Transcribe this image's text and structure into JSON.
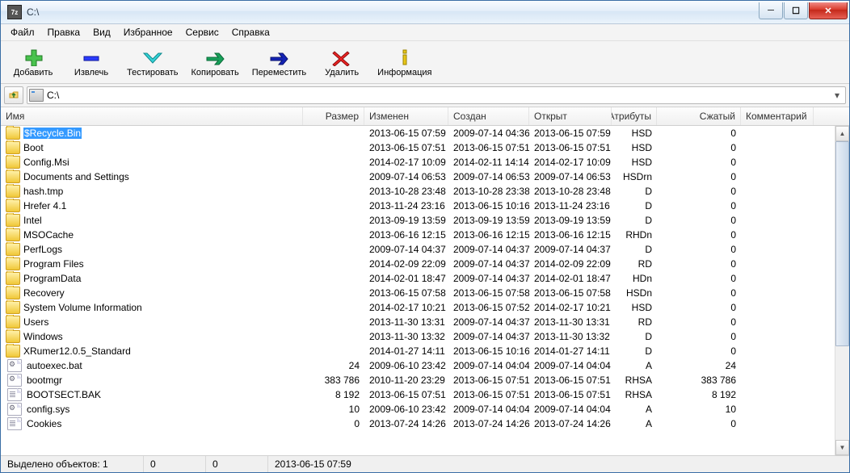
{
  "title": "C:\\",
  "appicon_label": "7z",
  "menu": [
    "Файл",
    "Правка",
    "Вид",
    "Избранное",
    "Сервис",
    "Справка"
  ],
  "toolbar": [
    {
      "id": "add",
      "label": "Добавить"
    },
    {
      "id": "extract",
      "label": "Извлечь"
    },
    {
      "id": "test",
      "label": "Тестировать"
    },
    {
      "id": "copy",
      "label": "Копировать"
    },
    {
      "id": "move",
      "label": "Переместить"
    },
    {
      "id": "delete",
      "label": "Удалить"
    },
    {
      "id": "info",
      "label": "Информация"
    }
  ],
  "path": "C:\\",
  "columns": {
    "name": "Имя",
    "size": "Размер",
    "mod": "Изменен",
    "cre": "Создан",
    "opn": "Открыт",
    "attr": "Атрибуты",
    "pack": "Сжатый",
    "comm": "Комментарий"
  },
  "rows": [
    {
      "icon": "folder",
      "name": "$Recycle.Bin",
      "size": "",
      "mod": "2013-06-15 07:59",
      "cre": "2009-07-14 04:36",
      "opn": "2013-06-15 07:59",
      "attr": "HSD",
      "pack": "0",
      "sel": true
    },
    {
      "icon": "folder",
      "name": "Boot",
      "size": "",
      "mod": "2013-06-15 07:51",
      "cre": "2013-06-15 07:51",
      "opn": "2013-06-15 07:51",
      "attr": "HSD",
      "pack": "0"
    },
    {
      "icon": "folder",
      "name": "Config.Msi",
      "size": "",
      "mod": "2014-02-17 10:09",
      "cre": "2014-02-11 14:14",
      "opn": "2014-02-17 10:09",
      "attr": "HSD",
      "pack": "0"
    },
    {
      "icon": "folder",
      "name": "Documents and Settings",
      "size": "",
      "mod": "2009-07-14 06:53",
      "cre": "2009-07-14 06:53",
      "opn": "2009-07-14 06:53",
      "attr": "HSDrn",
      "pack": "0"
    },
    {
      "icon": "folder",
      "name": "hash.tmp",
      "size": "",
      "mod": "2013-10-28 23:48",
      "cre": "2013-10-28 23:38",
      "opn": "2013-10-28 23:48",
      "attr": "D",
      "pack": "0"
    },
    {
      "icon": "folder",
      "name": "Hrefer 4.1",
      "size": "",
      "mod": "2013-11-24 23:16",
      "cre": "2013-06-15 10:16",
      "opn": "2013-11-24 23:16",
      "attr": "D",
      "pack": "0"
    },
    {
      "icon": "folder",
      "name": "Intel",
      "size": "",
      "mod": "2013-09-19 13:59",
      "cre": "2013-09-19 13:59",
      "opn": "2013-09-19 13:59",
      "attr": "D",
      "pack": "0"
    },
    {
      "icon": "folder",
      "name": "MSOCache",
      "size": "",
      "mod": "2013-06-16 12:15",
      "cre": "2013-06-16 12:15",
      "opn": "2013-06-16 12:15",
      "attr": "RHDn",
      "pack": "0"
    },
    {
      "icon": "folder",
      "name": "PerfLogs",
      "size": "",
      "mod": "2009-07-14 04:37",
      "cre": "2009-07-14 04:37",
      "opn": "2009-07-14 04:37",
      "attr": "D",
      "pack": "0"
    },
    {
      "icon": "folder",
      "name": "Program Files",
      "size": "",
      "mod": "2014-02-09 22:09",
      "cre": "2009-07-14 04:37",
      "opn": "2014-02-09 22:09",
      "attr": "RD",
      "pack": "0"
    },
    {
      "icon": "folder",
      "name": "ProgramData",
      "size": "",
      "mod": "2014-02-01 18:47",
      "cre": "2009-07-14 04:37",
      "opn": "2014-02-01 18:47",
      "attr": "HDn",
      "pack": "0"
    },
    {
      "icon": "folder",
      "name": "Recovery",
      "size": "",
      "mod": "2013-06-15 07:58",
      "cre": "2013-06-15 07:58",
      "opn": "2013-06-15 07:58",
      "attr": "HSDn",
      "pack": "0"
    },
    {
      "icon": "folder",
      "name": "System Volume Information",
      "size": "",
      "mod": "2014-02-17 10:21",
      "cre": "2013-06-15 07:52",
      "opn": "2014-02-17 10:21",
      "attr": "HSD",
      "pack": "0"
    },
    {
      "icon": "folder",
      "name": "Users",
      "size": "",
      "mod": "2013-11-30 13:31",
      "cre": "2009-07-14 04:37",
      "opn": "2013-11-30 13:31",
      "attr": "RD",
      "pack": "0"
    },
    {
      "icon": "folder",
      "name": "Windows",
      "size": "",
      "mod": "2013-11-30 13:32",
      "cre": "2009-07-14 04:37",
      "opn": "2013-11-30 13:32",
      "attr": "D",
      "pack": "0"
    },
    {
      "icon": "folder",
      "name": "XRumer12.0.5_Standard",
      "size": "",
      "mod": "2014-01-27 14:11",
      "cre": "2013-06-15 10:16",
      "opn": "2014-01-27 14:11",
      "attr": "D",
      "pack": "0"
    },
    {
      "icon": "gear",
      "name": "autoexec.bat",
      "size": "24",
      "mod": "2009-06-10 23:42",
      "cre": "2009-07-14 04:04",
      "opn": "2009-07-14 04:04",
      "attr": "A",
      "pack": "24"
    },
    {
      "icon": "gear",
      "name": "bootmgr",
      "size": "383 786",
      "mod": "2010-11-20 23:29",
      "cre": "2013-06-15 07:51",
      "opn": "2013-06-15 07:51",
      "attr": "RHSA",
      "pack": "383 786"
    },
    {
      "icon": "txt",
      "name": "BOOTSECT.BAK",
      "size": "8 192",
      "mod": "2013-06-15 07:51",
      "cre": "2013-06-15 07:51",
      "opn": "2013-06-15 07:51",
      "attr": "RHSA",
      "pack": "8 192"
    },
    {
      "icon": "gear",
      "name": "config.sys",
      "size": "10",
      "mod": "2009-06-10 23:42",
      "cre": "2009-07-14 04:04",
      "opn": "2009-07-14 04:04",
      "attr": "A",
      "pack": "10"
    },
    {
      "icon": "txt",
      "name": "Cookies",
      "size": "0",
      "mod": "2013-07-24 14:26",
      "cre": "2013-07-24 14:26",
      "opn": "2013-07-24 14:26",
      "attr": "A",
      "pack": "0"
    }
  ],
  "status": {
    "sel_label": "Выделено объектов: 1",
    "c1": "0",
    "c2": "0",
    "date": "2013-06-15 07:59"
  }
}
